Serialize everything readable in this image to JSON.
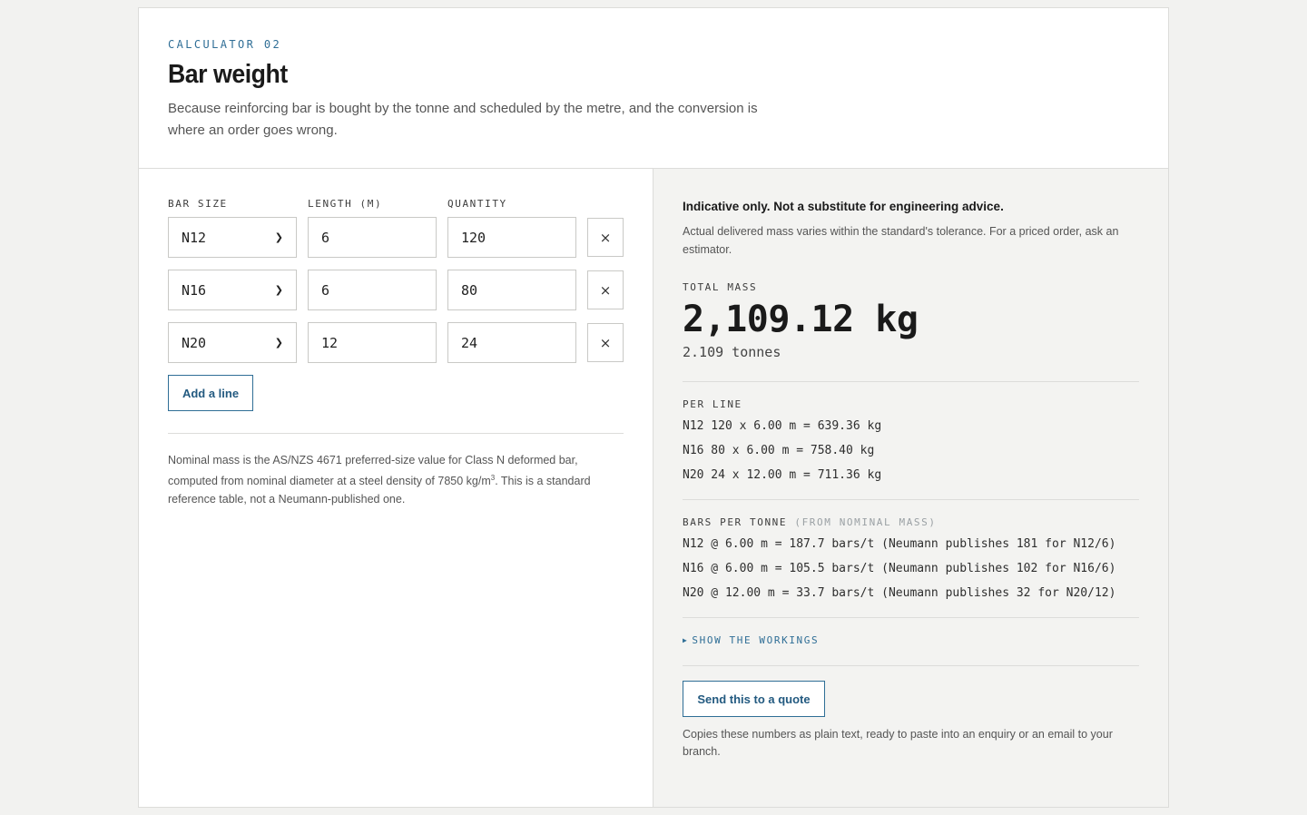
{
  "header": {
    "eyebrow": "CALCULATOR 02",
    "title": "Bar weight",
    "subtitle": "Because reinforcing bar is bought by the tonne and scheduled by the metre, and the conversion is where an order goes wrong."
  },
  "form": {
    "labels": {
      "bar_size": "BAR SIZE",
      "length": "LENGTH (M)",
      "quantity": "QUANTITY"
    },
    "rows": [
      {
        "bar_size": "N12",
        "length": "6",
        "quantity": "120",
        "remove": "×"
      },
      {
        "bar_size": "N16",
        "length": "6",
        "quantity": "80",
        "remove": "×"
      },
      {
        "bar_size": "N20",
        "length": "12",
        "quantity": "24",
        "remove": "×"
      }
    ],
    "add_label": "Add a line",
    "note_before_sup": "Nominal mass is the AS/NZS 4671 preferred-size value for Class N deformed bar, computed from nominal diameter at a steel density of 7850 kg/m",
    "note_sup": "3",
    "note_after_sup": ". This is a standard reference table, not a Neumann-published one."
  },
  "results": {
    "disclaimer_title": "Indicative only. Not a substitute for engineering advice.",
    "disclaimer_text": "Actual delivered mass varies within the standard's tolerance. For a priced order, ask an estimator.",
    "total_label": "TOTAL MASS",
    "total_value": "2,109.12 kg",
    "total_tonnes": "2.109 tonnes",
    "per_line_label": "PER LINE",
    "per_line": [
      "N12 120 x 6.00 m = 639.36 kg",
      "N16 80 x 6.00 m = 758.40 kg",
      "N20 24 x 12.00 m = 711.36 kg"
    ],
    "bars_per_tonne_label": "BARS PER TONNE",
    "bars_per_tonne_sub": "(FROM NOMINAL MASS)",
    "bars_per_tonne": [
      "N12 @ 6.00 m = 187.7 bars/t (Neumann publishes 181 for N12/6)",
      "N16 @ 6.00 m = 105.5 bars/t (Neumann publishes 102 for N16/6)",
      "N20 @ 12.00 m = 33.7 bars/t (Neumann publishes 32 for N20/12)"
    ],
    "workings_label": "SHOW THE WORKINGS",
    "quote_button": "Send this to a quote",
    "quote_note": "Copies these numbers as plain text, ready to paste into an enquiry or an email to your branch."
  },
  "colors": {
    "accent": "#2f6e96",
    "panel_bg": "#f3f3f1",
    "page_bg": "#f2f2f0"
  }
}
